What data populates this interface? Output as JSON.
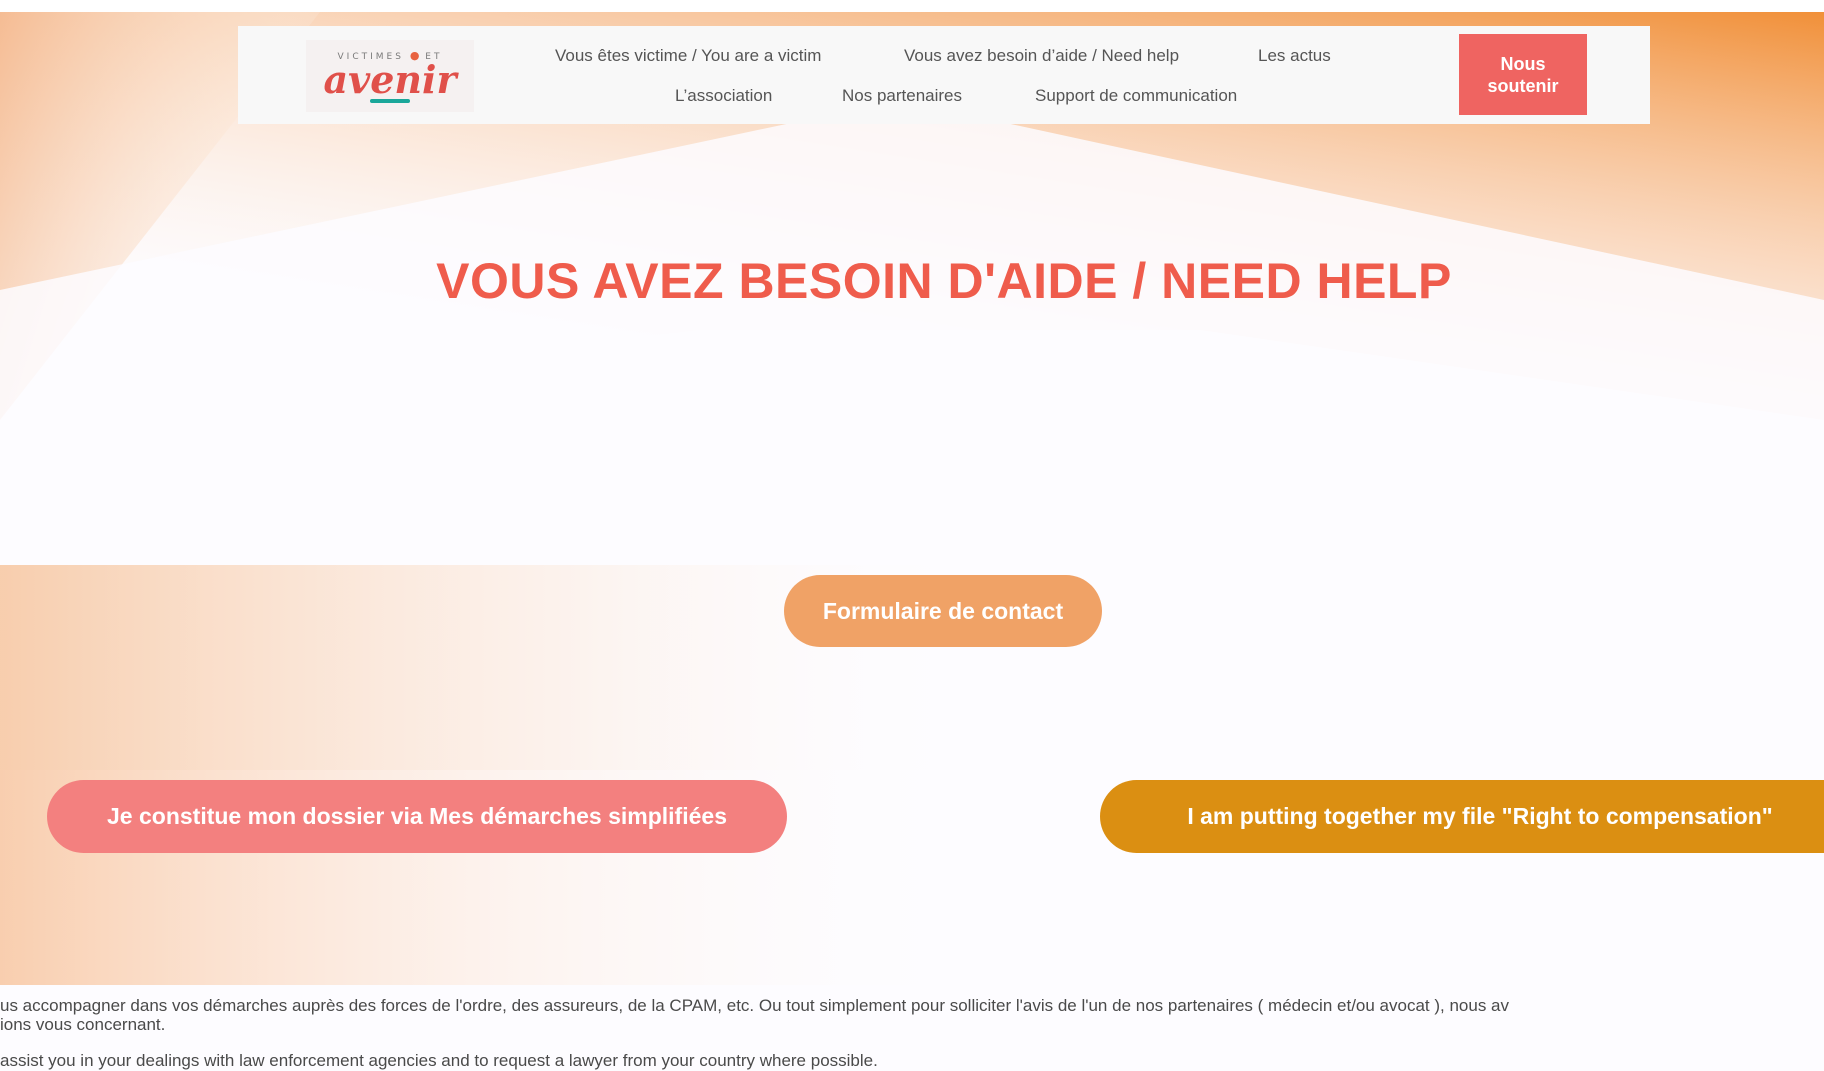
{
  "header": {
    "logo": {
      "small_text": "VICTIMES",
      "small_suffix": "ET",
      "big_text": "avenir"
    },
    "nav": [
      {
        "label": "Vous êtes victime / You are a victim"
      },
      {
        "label": "Vous avez besoin d’aide / Need help"
      },
      {
        "label": "Les actus"
      },
      {
        "label": "L’association"
      },
      {
        "label": "Nos partenaires"
      },
      {
        "label": "Support de communication"
      }
    ],
    "support_button": "Nous soutenir"
  },
  "main": {
    "title": "VOUS AVEZ BESOIN D'AIDE / NEED HELP",
    "contact_button": "Formulaire de contact",
    "dossier_button": "Je constitue mon dossier via Mes démarches simplifiées",
    "compensation_button": "I am putting together my file \"Right to compensation\"",
    "paragraph_fr_line1": "us accompagner dans vos démarches auprès des forces de l'ordre, des assureurs, de la CPAM, etc. Ou tout simplement pour solliciter l'avis de l'un de nos partenaires ( médecin et/ou avocat ), nous av",
    "paragraph_fr_line2": "ions vous concernant.",
    "paragraph_en": "assist you in your dealings with law enforcement agencies and to request a lawyer from your country where possible."
  },
  "colors": {
    "accent": "#ef5c4c",
    "support_button": "#ef6461",
    "contact_button": "#f0a266",
    "dossier_button": "#f3807f",
    "compensation_button": "#db8f12"
  }
}
